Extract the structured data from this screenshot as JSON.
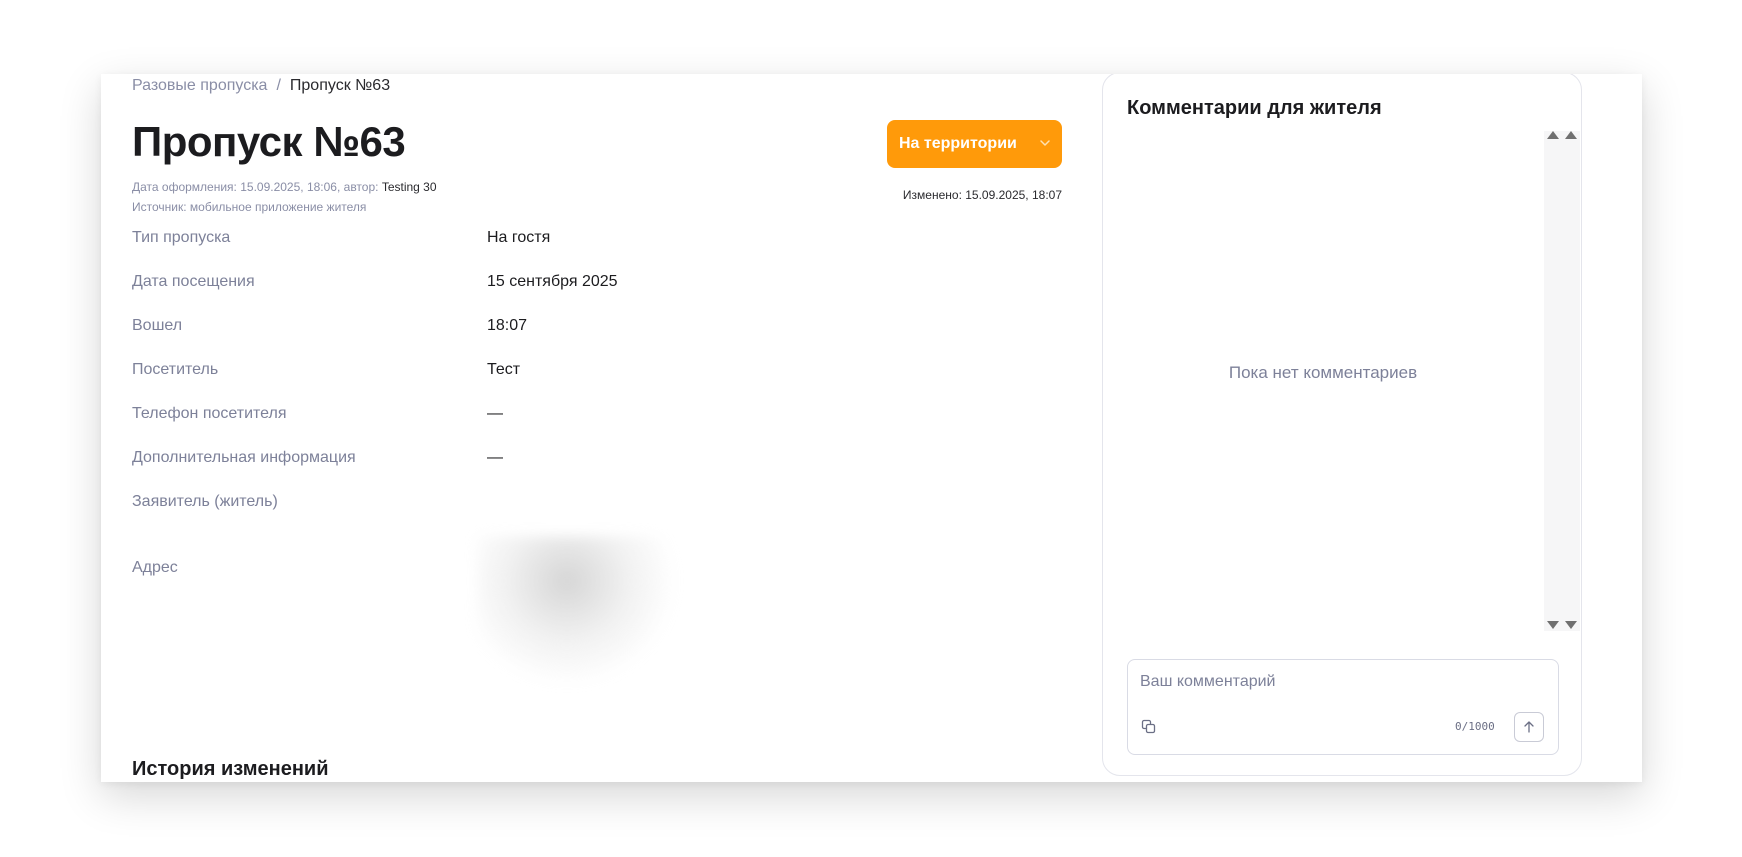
{
  "breadcrumb": {
    "parent": "Разовые пропуска",
    "separator": "/",
    "current": "Пропуск №63"
  },
  "header": {
    "title": "Пропуск №63",
    "status_label": "На территории",
    "created_label": "Дата оформления: 15.09.2025, 18:06, автор:",
    "author": "Testing 30",
    "source": "Источник: мобильное приложение жителя",
    "changed": "Изменено: 15.09.2025, 18:07"
  },
  "details": [
    {
      "label": "Тип пропуска",
      "value": "На гостя"
    },
    {
      "label": "Дата посещения",
      "value": "15 сентября 2025"
    },
    {
      "label": "Вошел",
      "value": "18:07"
    },
    {
      "label": "Посетитель",
      "value": "Тест"
    },
    {
      "label": "Телефон посетителя",
      "value": "—"
    },
    {
      "label": "Дополнительная информация",
      "value": "—"
    },
    {
      "label": "Заявитель (житель)",
      "value": ""
    },
    {
      "label": "Адрес",
      "value": ""
    }
  ],
  "history": {
    "title": "История изменений"
  },
  "comments": {
    "title": "Комментарии для жителя",
    "empty_text": "Пока нет комментариев",
    "placeholder": "Ваш комментарий",
    "counter": "0/1000"
  },
  "colors": {
    "accent": "#ff9a0a",
    "muted_text": "#7d8199"
  },
  "icons": {
    "status_chevron": "chevron-down-icon",
    "attach": "copy-icon",
    "send": "arrow-up-icon"
  }
}
